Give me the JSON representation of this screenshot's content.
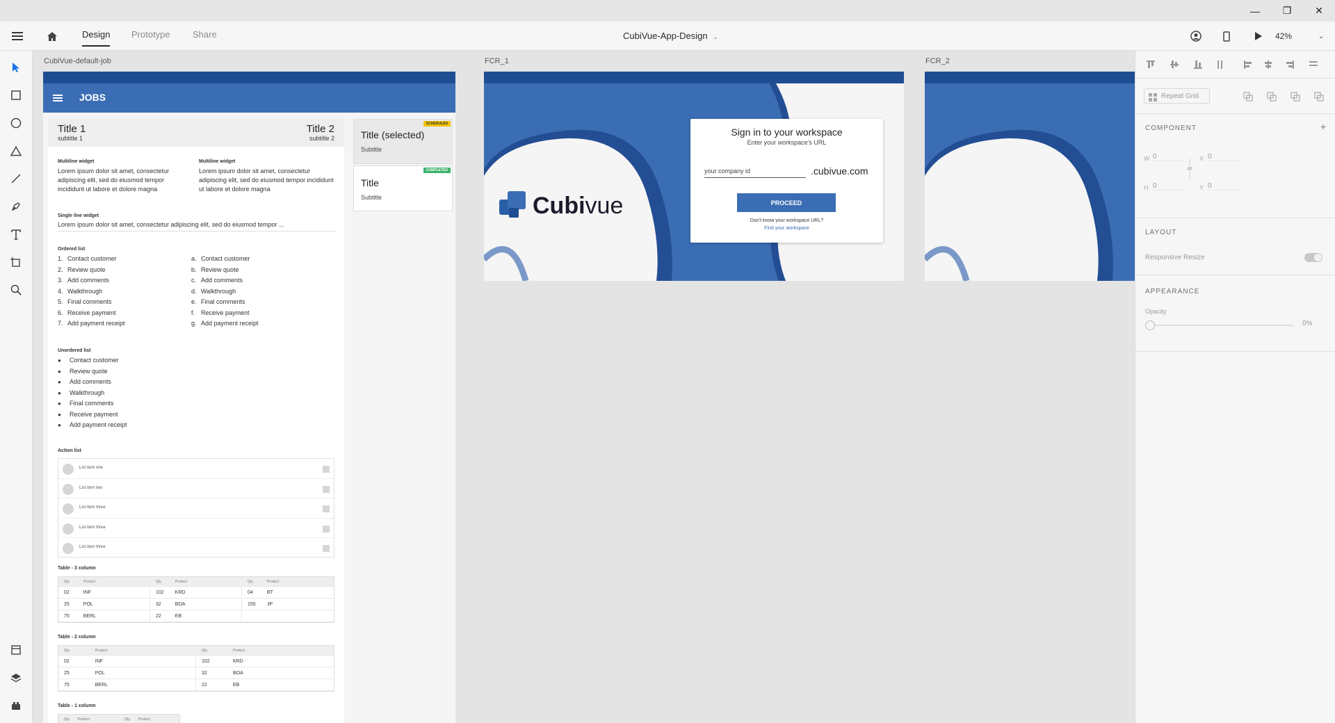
{
  "window": {
    "minimize": "—",
    "restore": "❐",
    "close": "✕"
  },
  "topbar": {
    "tabs": [
      "Design",
      "Prototype",
      "Share"
    ],
    "doc_title": "CubiVue-App-Design",
    "zoom": "42%"
  },
  "artboards": {
    "job": {
      "label": "CubiVue-default-job",
      "header_title": "JOBS",
      "title1": "Title 1",
      "subtitle1": "subtitle 1",
      "title2": "Title 2",
      "subtitle2": "subtitle 2",
      "multiline_label": "Multiline widget",
      "multiline_text": "Lorem ipsum dolor sit amet, consectetur adipiscing elit, sed do eiusmod tempor incididunt ut labore et dolore magna",
      "singleline_label": "Single line widget",
      "singleline_text": "Lorem ipsum dolor sit amet, consectetur adipiscing elit, sed do eiusmod tempor ...",
      "ordered_label": "Ordered list",
      "ordered_items": [
        "Contact customer",
        "Review quote",
        "Add comments",
        "Walkthrough",
        "Final comments",
        "Receive payment",
        "Add payment receipt"
      ],
      "ordered_nums": [
        "1.",
        "2.",
        "3.",
        "4.",
        "5.",
        "6.",
        "7."
      ],
      "ordered_letters": [
        "a.",
        "b.",
        "c.",
        "d.",
        "e.",
        "f.",
        "g."
      ],
      "unordered_label": "Unordered list",
      "action_label": "Action list",
      "action_items": [
        "List item one",
        "List item two",
        "List item three",
        "List item three",
        "List item three"
      ],
      "table3_label": "Table - 3 column",
      "table2_label": "Table - 2 column",
      "table1_label": "Table - 1 column",
      "col_qty": "Qty.",
      "col_product": "Product",
      "table3_rows": [
        [
          "02",
          "INF",
          "102",
          "KRD",
          "04",
          "BT"
        ],
        [
          "25",
          "POL",
          "32",
          "BOA",
          "155",
          "JP"
        ],
        [
          "75",
          "BERL",
          "22",
          "EB",
          "",
          ""
        ]
      ],
      "table2_rows": [
        [
          "02",
          "INF",
          "102",
          "KRD"
        ],
        [
          "25",
          "POL",
          "32",
          "BOA"
        ],
        [
          "75",
          "BERL",
          "22",
          "EB"
        ]
      ],
      "card1_title": "Title (selected)",
      "card1_subtitle": "Subtitle",
      "card1_badge": "SCHEDULED",
      "card2_title": "Title",
      "card2_subtitle": "Subtitle",
      "card2_badge": "COMPLETED"
    },
    "fcr1": {
      "label": "FCR_1",
      "logo_text_bold": "Cubi",
      "logo_text_light": "vue",
      "signin_title": "Sign in to your workspace",
      "signin_sub": "Enter your workspace's URL",
      "input_placeholder": "your company id",
      "domain_suffix": ".cubivue.com",
      "proceed": "PROCEED",
      "help_text": "Don't know your workspace URL?",
      "help_link": "Find your workspace"
    },
    "fcr2": {
      "label": "FCR_2"
    }
  },
  "props": {
    "repeat_grid": "Repeat Grid",
    "component": "COMPONENT",
    "w_label": "W",
    "w_value": "0",
    "x_label": "X",
    "x_value": "0",
    "h_label": "H",
    "h_value": "0",
    "y_label": "Y",
    "y_value": "0",
    "layout": "LAYOUT",
    "responsive_resize": "Responsive Resize",
    "appearance": "APPEARANCE",
    "opacity_label": "Opacity",
    "opacity_value": "0%"
  },
  "colors": {
    "brand_blue": "#3b6db4",
    "dark_blue": "#1f4d91",
    "scheduled": "#f2c300",
    "completed": "#3db36b"
  }
}
